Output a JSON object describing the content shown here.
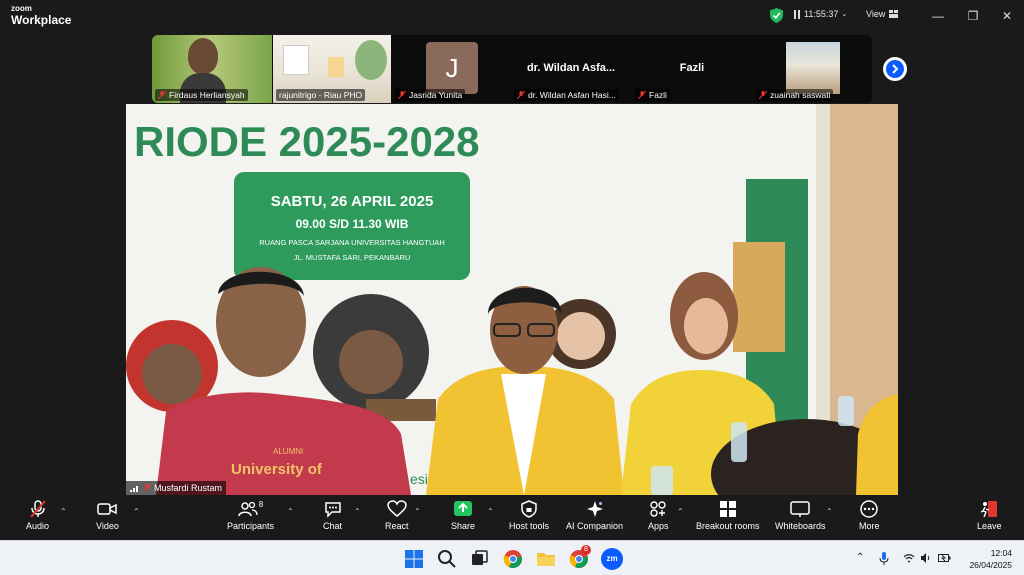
{
  "app": {
    "logo_line1": "zoom",
    "logo_line2": "Workplace"
  },
  "titlebar": {
    "timer": "11:55:37",
    "view_label": "View"
  },
  "participants_strip": [
    {
      "name": "Firdaus Herliansyah",
      "muted": true
    },
    {
      "name": "rajunitrigo - Riau PHO",
      "muted": false
    },
    {
      "name": "Jasrida Yunita",
      "muted": true,
      "avatar_letter": "J"
    },
    {
      "name": "dr. Wildan Asfan Hasi...",
      "muted": true,
      "display_name": "dr. Wildan Asfa..."
    },
    {
      "name": "Fazli",
      "muted": true,
      "display_name": "Fazli"
    },
    {
      "name": "zuainah saswati",
      "muted": true
    }
  ],
  "main_video": {
    "speaker": "Musfardi Rustam",
    "banner_title": "RIODE 2025-2028",
    "banner_date": "SABTU, 26 APRIL 2025",
    "banner_time": "09.00 S/D 11.30 WIB",
    "banner_venue_1": "RUANG PASCA SARJANA UNIVERSITAS HANGTUAH",
    "banner_venue_2": "JL. MUSTAFA SARI, PEKANBARU",
    "shirt_text_1": "ALUMNI",
    "shirt_text_2": "University of",
    "partial_text": "esi"
  },
  "toolbar": {
    "audio": "Audio",
    "video": "Video",
    "participants": "Participants",
    "participants_count": "8",
    "chat": "Chat",
    "react": "React",
    "share": "Share",
    "host_tools": "Host tools",
    "ai_companion": "AI Companion",
    "apps": "Apps",
    "breakout_rooms": "Breakout rooms",
    "whiteboards": "Whiteboards",
    "more": "More",
    "leave": "Leave"
  },
  "taskbar": {
    "time": "12:04",
    "date": "26/04/2025",
    "chrome_badge": "8",
    "zoom_label": "zm"
  },
  "colors": {
    "zoom_blue": "#0b5cff",
    "share_green": "#22c55e",
    "leave_red": "#e0362d",
    "banner_green": "#2e8b57"
  }
}
